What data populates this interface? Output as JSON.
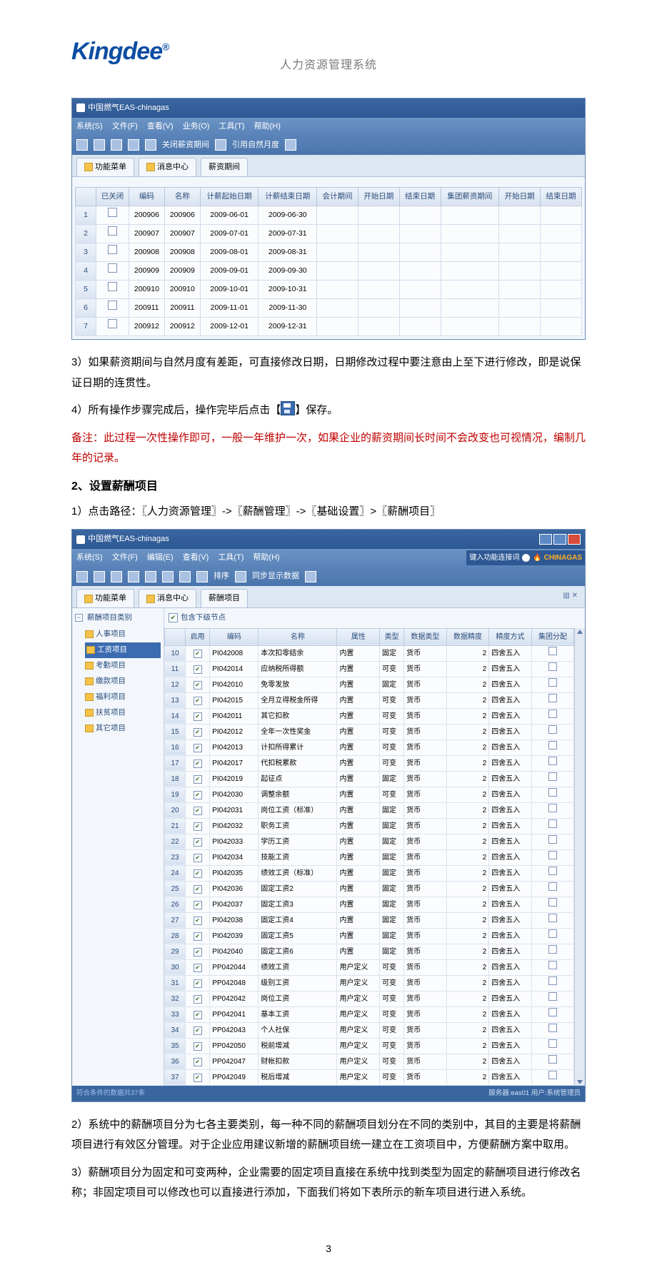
{
  "brand": {
    "logo": "Kingdee",
    "reg": "®",
    "subtitle": "人力资源管理系统"
  },
  "win1": {
    "title": "中国燃气EAS-chinagas",
    "menu": [
      "系统(S)",
      "文件(F)",
      "查看(V)",
      "业务(O)",
      "工具(T)",
      "帮助(H)"
    ],
    "tool": [
      "关闭薪资期间",
      "引用自然月度"
    ],
    "tabs": {
      "func": "功能菜单",
      "msg": "消息中心",
      "period": "薪资期间"
    },
    "cols": [
      "",
      "已关闭",
      "编码",
      "名称",
      "计薪起始日期",
      "计薪结束日期",
      "会计期间",
      "开始日期",
      "结束日期",
      "集团薪资期间",
      "开始日期",
      "结束日期"
    ]
  },
  "rows1": [
    {
      "n": "1",
      "code": "200906",
      "name": "200906",
      "s": "2009-06-01",
      "e": "2009-06-30"
    },
    {
      "n": "2",
      "code": "200907",
      "name": "200907",
      "s": "2009-07-01",
      "e": "2009-07-31"
    },
    {
      "n": "3",
      "code": "200908",
      "name": "200908",
      "s": "2009-08-01",
      "e": "2009-08-31"
    },
    {
      "n": "4",
      "code": "200909",
      "name": "200909",
      "s": "2009-09-01",
      "e": "2009-09-30"
    },
    {
      "n": "5",
      "code": "200910",
      "name": "200910",
      "s": "2009-10-01",
      "e": "2009-10-31"
    },
    {
      "n": "6",
      "code": "200911",
      "name": "200911",
      "s": "2009-11-01",
      "e": "2009-11-30"
    },
    {
      "n": "7",
      "code": "200912",
      "name": "200912",
      "s": "2009-12-01",
      "e": "2009-12-31"
    }
  ],
  "body": {
    "p3": "3）如果薪资期间与自然月度有差距，可直接修改日期，日期修改过程中要注意由上至下进行修改，即是说保证日期的连贯性。",
    "p4a": "4）所有操作步骤完成后，操作完毕后点击【",
    "p4b": "】保存。",
    "note": "备注：此过程一次性操作即可，一般一年维护一次，如果企业的薪资期间长时间不会改变也可视情况，编制几年的记录。",
    "h2": "2、设置薪酬项目",
    "path": "1）点击路径：〖人力资源管理〗->〖薪酬管理〗->〖基础设置〗>〖薪酬项目〗",
    "p2b": "2）系统中的薪酬项目分为七各主要类别，每一种不同的薪酬项目划分在不同的类别中，其目的主要是将薪酬项目进行有效区分管理。对于企业应用建议新增的薪酬项目统一建立在工资项目中，方便薪酬方案中取用。",
    "p3b": "3）薪酬项目分为固定和可变两种，企业需要的固定项目直接在系统中找到类型为固定的薪酬项目进行修改名称；非固定项目可以修改也可以直接进行添加，下面我们将如下表所示的新车项目进行进入系统。"
  },
  "win2": {
    "title": "中国燃气EAS-chinagas",
    "menu": [
      "系统(S)",
      "文件(F)",
      "编辑(E)",
      "查看(V)",
      "工具(T)",
      "帮助(H)"
    ],
    "toolA": "排序",
    "toolB": "同步显示数据",
    "userhint": "键入功能连接词",
    "brand": "CHINAGAS",
    "tabs": {
      "func": "功能菜单",
      "msg": "消息中心",
      "item": "薪酬项目"
    },
    "tree_root": "薪酬项目类别",
    "tree": [
      "人事项目",
      "工资项目",
      "考勤项目",
      "缴款项目",
      "福利项目",
      "扶贫项目",
      "其它项目"
    ],
    "tree_sel": 1,
    "incl": "包含下级节点",
    "cols": [
      "",
      "启用",
      "编码",
      "名称",
      "属性",
      "类型",
      "数据类型",
      "数据精度",
      "精度方式",
      "集团分配"
    ],
    "status_left": "符合条件的数据共37条",
    "status_right": "服务器:eas01 用户:系统管理员"
  },
  "rows2": [
    {
      "n": "10",
      "code": "PI042008",
      "name": "本次扣零结余",
      "attr": "内置",
      "type": "固定",
      "dt": "货币",
      "p": "2",
      "m": "四舍五入",
      "g": false
    },
    {
      "n": "11",
      "code": "PI042014",
      "name": "应纳税所得额",
      "attr": "内置",
      "type": "可变",
      "dt": "货币",
      "p": "2",
      "m": "四舍五入",
      "g": false
    },
    {
      "n": "12",
      "code": "PI042010",
      "name": "免零发放",
      "attr": "内置",
      "type": "固定",
      "dt": "货币",
      "p": "2",
      "m": "四舍五入",
      "g": false
    },
    {
      "n": "13",
      "code": "PI042015",
      "name": "全月立得税金所得",
      "attr": "内置",
      "type": "可变",
      "dt": "货币",
      "p": "2",
      "m": "四舍五入",
      "g": false
    },
    {
      "n": "14",
      "code": "PI042011",
      "name": "其它扣款",
      "attr": "内置",
      "type": "可变",
      "dt": "货币",
      "p": "2",
      "m": "四舍五入",
      "g": false
    },
    {
      "n": "15",
      "code": "PI042012",
      "name": "全年一次性奖金",
      "attr": "内置",
      "type": "可变",
      "dt": "货币",
      "p": "2",
      "m": "四舍五入",
      "g": false
    },
    {
      "n": "16",
      "code": "PI042013",
      "name": "计扣所得累计",
      "attr": "内置",
      "type": "可变",
      "dt": "货币",
      "p": "2",
      "m": "四舍五入",
      "g": false
    },
    {
      "n": "17",
      "code": "PI042017",
      "name": "代扣税累款",
      "attr": "内置",
      "type": "可变",
      "dt": "货币",
      "p": "2",
      "m": "四舍五入",
      "g": false
    },
    {
      "n": "18",
      "code": "PI042019",
      "name": "起征点",
      "attr": "内置",
      "type": "固定",
      "dt": "货币",
      "p": "2",
      "m": "四舍五入",
      "g": false
    },
    {
      "n": "19",
      "code": "PI042030",
      "name": "调整余额",
      "attr": "内置",
      "type": "可变",
      "dt": "货币",
      "p": "2",
      "m": "四舍五入",
      "g": false
    },
    {
      "n": "20",
      "code": "PI042031",
      "name": "岗位工资（标准）",
      "attr": "内置",
      "type": "固定",
      "dt": "货币",
      "p": "2",
      "m": "四舍五入",
      "g": false
    },
    {
      "n": "21",
      "code": "PI042032",
      "name": "职务工资",
      "attr": "内置",
      "type": "固定",
      "dt": "货币",
      "p": "2",
      "m": "四舍五入",
      "g": false
    },
    {
      "n": "22",
      "code": "PI042033",
      "name": "学历工资",
      "attr": "内置",
      "type": "固定",
      "dt": "货币",
      "p": "2",
      "m": "四舍五入",
      "g": false
    },
    {
      "n": "23",
      "code": "PI042034",
      "name": "技能工资",
      "attr": "内置",
      "type": "固定",
      "dt": "货币",
      "p": "2",
      "m": "四舍五入",
      "g": false
    },
    {
      "n": "24",
      "code": "PI042035",
      "name": "绩效工资（标准）",
      "attr": "内置",
      "type": "固定",
      "dt": "货币",
      "p": "2",
      "m": "四舍五入",
      "g": false
    },
    {
      "n": "25",
      "code": "PI042036",
      "name": "固定工资2",
      "attr": "内置",
      "type": "固定",
      "dt": "货币",
      "p": "2",
      "m": "四舍五入",
      "g": false
    },
    {
      "n": "26",
      "code": "PI042037",
      "name": "固定工资3",
      "attr": "内置",
      "type": "固定",
      "dt": "货币",
      "p": "2",
      "m": "四舍五入",
      "g": false
    },
    {
      "n": "27",
      "code": "PI042038",
      "name": "固定工资4",
      "attr": "内置",
      "type": "固定",
      "dt": "货币",
      "p": "2",
      "m": "四舍五入",
      "g": false
    },
    {
      "n": "28",
      "code": "PI042039",
      "name": "固定工资5",
      "attr": "内置",
      "type": "固定",
      "dt": "货币",
      "p": "2",
      "m": "四舍五入",
      "g": false
    },
    {
      "n": "29",
      "code": "PI042040",
      "name": "固定工资6",
      "attr": "内置",
      "type": "固定",
      "dt": "货币",
      "p": "2",
      "m": "四舍五入",
      "g": false
    },
    {
      "n": "30",
      "code": "PP042044",
      "name": "绩效工资",
      "attr": "用户定义",
      "type": "可变",
      "dt": "货币",
      "p": "2",
      "m": "四舍五入",
      "g": false
    },
    {
      "n": "31",
      "code": "PP042048",
      "name": "级别工资",
      "attr": "用户定义",
      "type": "可变",
      "dt": "货币",
      "p": "2",
      "m": "四舍五入",
      "g": false
    },
    {
      "n": "32",
      "code": "PP042042",
      "name": "岗位工资",
      "attr": "用户定义",
      "type": "可变",
      "dt": "货币",
      "p": "2",
      "m": "四舍五入",
      "g": false
    },
    {
      "n": "33",
      "code": "PP042041",
      "name": "基本工资",
      "attr": "用户定义",
      "type": "可变",
      "dt": "货币",
      "p": "2",
      "m": "四舍五入",
      "g": false
    },
    {
      "n": "34",
      "code": "PP042043",
      "name": "个人社保",
      "attr": "用户定义",
      "type": "可变",
      "dt": "货币",
      "p": "2",
      "m": "四舍五入",
      "g": false
    },
    {
      "n": "35",
      "code": "PP042050",
      "name": "税前增减",
      "attr": "用户定义",
      "type": "可变",
      "dt": "货币",
      "p": "2",
      "m": "四舍五入",
      "g": false
    },
    {
      "n": "36",
      "code": "PP042047",
      "name": "财帐扣款",
      "attr": "用户定义",
      "type": "可变",
      "dt": "货币",
      "p": "2",
      "m": "四舍五入",
      "g": false
    },
    {
      "n": "37",
      "code": "PP042049",
      "name": "税后增减",
      "attr": "用户定义",
      "type": "可变",
      "dt": "货币",
      "p": "2",
      "m": "四舍五入",
      "g": false
    }
  ],
  "pagenum": "3"
}
